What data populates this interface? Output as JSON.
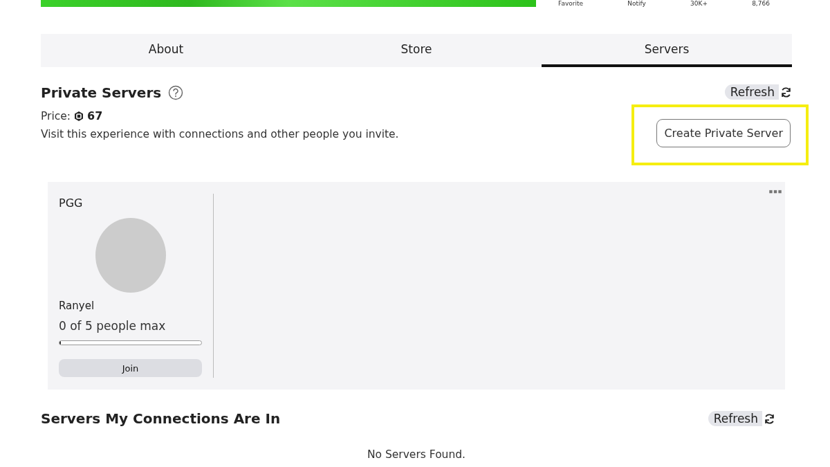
{
  "header": {
    "stats": [
      {
        "label": "Favorite"
      },
      {
        "label": "Notify"
      },
      {
        "label": "30K+"
      },
      {
        "label": "8,766"
      }
    ]
  },
  "tabs": [
    {
      "label": "About",
      "selected": false
    },
    {
      "label": "Store",
      "selected": false
    },
    {
      "label": "Servers",
      "selected": true
    }
  ],
  "private_servers": {
    "title": "Private Servers",
    "refresh": "Refresh",
    "price_label": "Price:",
    "price": "67",
    "description": "Visit this experience with connections and other people you invite.",
    "create_button": "Create Private Server",
    "highlighted": true,
    "servers": [
      {
        "name": "PGG",
        "owner": "Ranyel",
        "capacity": "0 of 5 people max",
        "level": 0.0,
        "join": "Join"
      }
    ]
  },
  "connections": {
    "title": "Servers My Connections Are In",
    "refresh": "Refresh",
    "empty": "No Servers Found."
  }
}
